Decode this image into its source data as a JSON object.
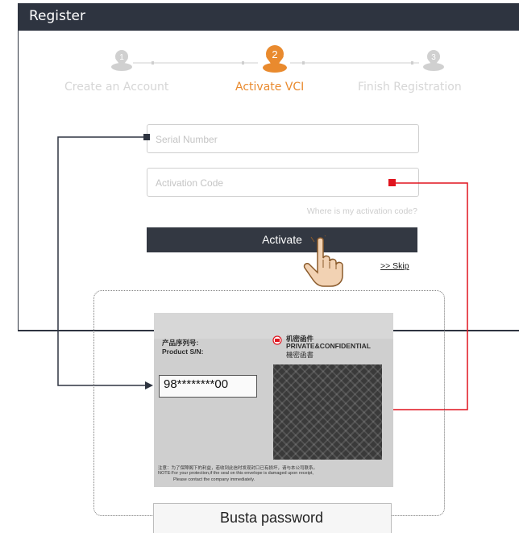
{
  "window": {
    "title": "Register"
  },
  "steps": [
    {
      "number": "1",
      "label": "Create an Account"
    },
    {
      "number": "2",
      "label": "Activate VCI"
    },
    {
      "number": "3",
      "label": "Finish Registration"
    }
  ],
  "form": {
    "serial_placeholder": "Serial Number",
    "activation_placeholder": "Activation Code",
    "help_link": "Where is my activation code?",
    "activate_label": "Activate",
    "skip_label": ">> Skip"
  },
  "envelope": {
    "product_label_cn": "产品序列号:",
    "product_label_en": "Product S/N:",
    "serial": "98********00",
    "conf_cn": "机密函件",
    "conf_en": "PRIVATE&CONFIDENTIAL",
    "conf_cn2": "機密函書",
    "note_cn": "注意：为了保障阁下的利益，若收到此信时发现封口已有损坏，请与本公司联系。",
    "note_en1": "NOTE:For your protection,if the seal on this envelope is damaged upon receipt,",
    "note_en2": "Please contact the company immediately."
  },
  "caption": "Busta password",
  "colors": {
    "accent": "#e98a2e",
    "dark": "#2e3440",
    "red": "#e0141e"
  }
}
